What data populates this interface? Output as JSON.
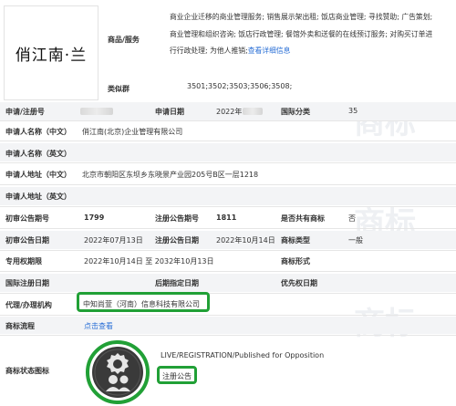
{
  "logo": {
    "text": "俏江南·兰"
  },
  "goods_services": {
    "label": "商品/服务",
    "lines": [
      "商业企业迁移的商业管理服务; 销售展示架出租; 饭店商业管理; 寻找赞助; 广告策划;",
      "商业管理和组织咨询; 饭店行政管理; 餐馆外卖和送餐的在线预订服务; 对购买订单进",
      "行行政处理; 为他人推销;"
    ],
    "more_link": "查看详细信息"
  },
  "similar_groups": {
    "label": "类似群",
    "value": "3501;3502;3503;3506;3508;"
  },
  "fields": {
    "app_no_label": "申请/注册号",
    "app_date_label": "申请日期",
    "app_date_value": "2022年",
    "intl_class_label": "国际分类",
    "intl_class_value": "35",
    "applicant_cn_label": "申请人名称（中文）",
    "applicant_cn_value": "俏江南(北京)企业管理有限公司",
    "applicant_en_label": "申请人名称（英文）",
    "address_cn_label": "申请人地址（中文）",
    "address_cn_value": "北京市朝阳区东坝乡东晓景产业园205号B区一层1218",
    "address_en_label": "申请人地址（英文）",
    "prelim_no_label": "初审公告期号",
    "prelim_no_value": "1799",
    "reg_no_label": "注册公告期号",
    "reg_no_value": "1811",
    "shared_label": "是否共有商标",
    "shared_value": "否",
    "prelim_date_label": "初审公告日期",
    "prelim_date_value": "2022年07月13日",
    "reg_date_label": "注册公告日期",
    "reg_date_value": "2022年10月14日",
    "tm_type_label": "商标类型",
    "tm_type_value": "一般",
    "exclusive_label": "专用权期限",
    "exclusive_value": "2022年10月14日 至 2032年10月13日",
    "tm_form_label": "商标形式",
    "intl_reg_date_label": "国际注册日期",
    "later_date_label": "后期指定日期",
    "priority_date_label": "优先权日期",
    "agent_label": "代理/办理机构",
    "agent_value": "中知尚萱（河南）信息科技有限公司",
    "process_label": "商标流程",
    "process_link": "点击查看",
    "status_label": "商标状态图标",
    "status_en": "LIVE/REGISTRATION/Published for Opposition",
    "status_cn": "注册公告"
  },
  "colors": {
    "highlight": "#21a036",
    "link": "#2a6fd6",
    "shade": "#f3f4f6"
  },
  "watermark": {
    "text": "商标"
  }
}
